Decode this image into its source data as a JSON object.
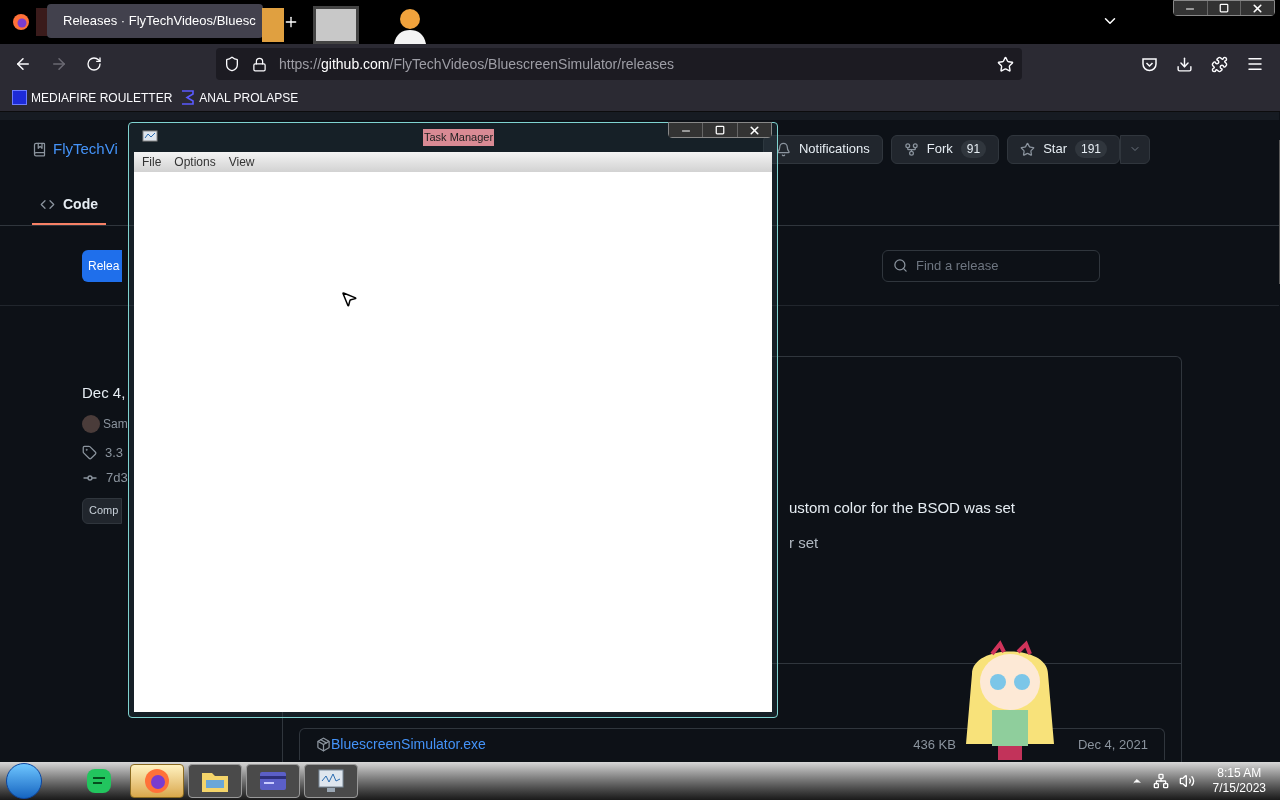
{
  "browser": {
    "tabs": [
      {
        "title": "Releases · FlyTechVideos/Bluesc",
        "selected": true
      }
    ],
    "url": {
      "scheme": "https://",
      "host": "github.com",
      "path": "/FlyTechVideos/BluescreenSimulator/releases"
    },
    "bookmarks": [
      {
        "label": "MEDIAFIRE ROULETTER",
        "kind": "square"
      },
      {
        "label": "ANAL PROLAPSE",
        "kind": "sigma"
      }
    ]
  },
  "repo": {
    "owner": "FlyTechVi",
    "actions": [
      {
        "label": "Notifications",
        "kind": "bell"
      },
      {
        "label": "Fork",
        "count": "91",
        "kind": "fork"
      },
      {
        "label": "Star",
        "count": "191",
        "kind": "star"
      }
    ],
    "tabs": [
      {
        "label": "Code",
        "selected": true
      }
    ],
    "releases_button": "Relea",
    "search": {
      "placeholder": "Find a release"
    },
    "release": {
      "date": "Dec 4,",
      "author": "Sam",
      "tag": "3.3",
      "commit": "7d3",
      "compare": "Comp",
      "notes": [
        "ustom color for the BSOD was set",
        "r set"
      ]
    },
    "asset": {
      "name": "BluescreenSimulator.exe",
      "size": "436 KB",
      "date": "Dec 4, 2021"
    }
  },
  "task_manager": {
    "title": "Task Manager",
    "menu": [
      "File",
      "Options",
      "View"
    ]
  },
  "taskbar": {
    "apps": [
      {
        "kind": "chat",
        "selected": false
      },
      {
        "kind": "firefox",
        "selected": true
      },
      {
        "kind": "folder",
        "selected": false
      },
      {
        "kind": "card",
        "selected": false
      },
      {
        "kind": "monitor",
        "selected": false
      }
    ],
    "time": "8:15 AM",
    "date": "7/15/2023"
  }
}
